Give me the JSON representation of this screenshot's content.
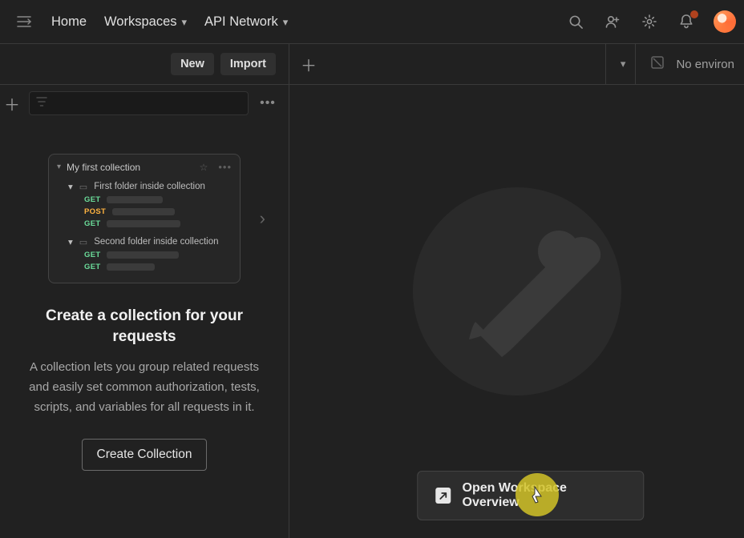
{
  "topnav": {
    "items": [
      "Home",
      "Workspaces",
      "API Network"
    ]
  },
  "secbar": {
    "new_label": "New",
    "import_label": "Import",
    "env_text": "No environ"
  },
  "sidebar": {
    "filter_placeholder": "",
    "illus": {
      "collection_title": "My first collection",
      "folder1": "First folder inside collection",
      "folder2": "Second folder inside collection",
      "methods": {
        "get": "GET",
        "post": "POST"
      }
    },
    "headline": "Create a collection for your requests",
    "desc": "A collection lets you group related requests and easily set common authorization, tests, scripts, and variables for all requests in it.",
    "create_label": "Create Collection"
  },
  "rightpane": {
    "overview_label": "Open Workspace Overview"
  }
}
